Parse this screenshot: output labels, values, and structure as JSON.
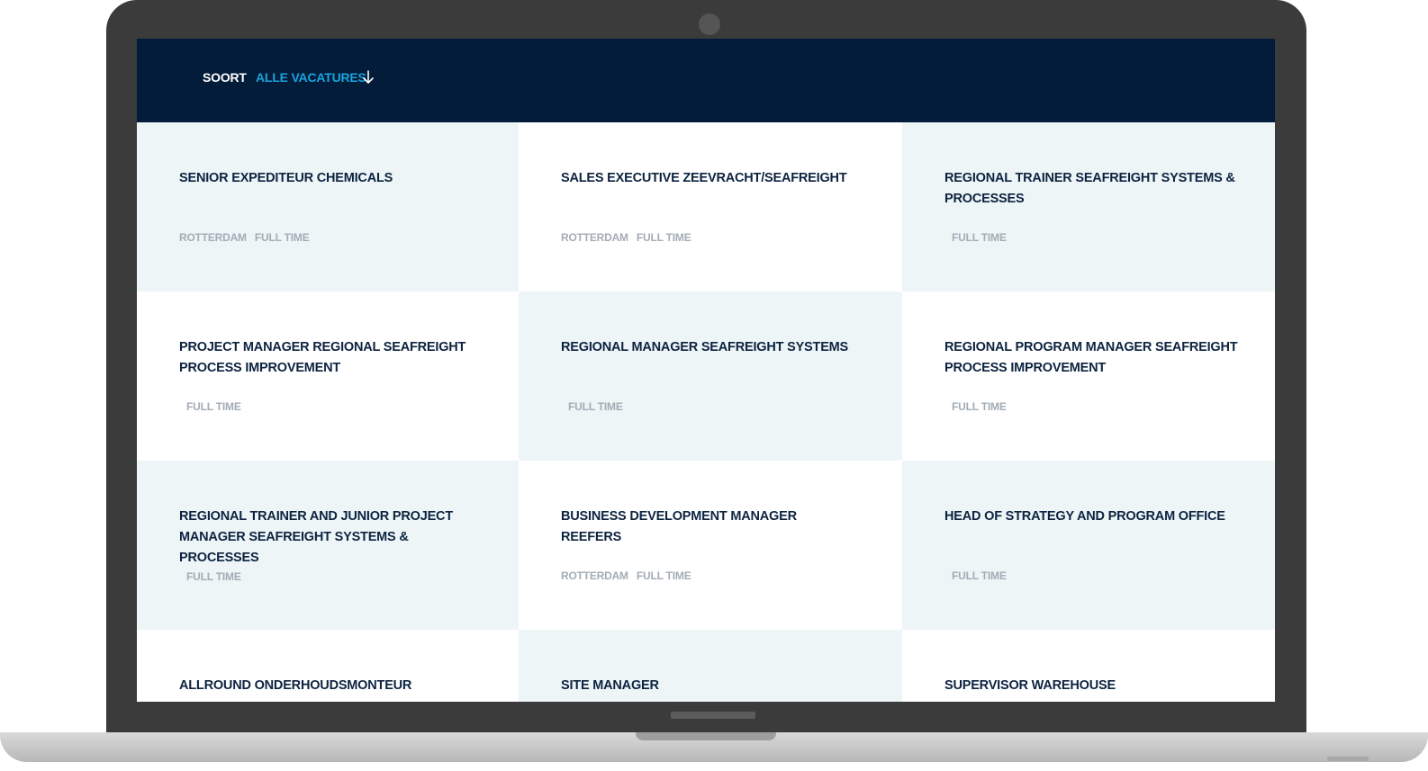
{
  "filter": {
    "label": "SOORT",
    "value": "ALLE VACATURES",
    "accent_color": "#1aa3dd",
    "header_bg": "#021c3a",
    "icon": "arrow-down-icon"
  },
  "jobs": [
    {
      "title": "SENIOR EXPEDITEUR CHEMICALS",
      "location": "ROTTERDAM",
      "type": "FULL TIME"
    },
    {
      "title": "SALES EXECUTIVE ZEEVRACHT/SEAFREIGHT",
      "location": "ROTTERDAM",
      "type": "FULL TIME"
    },
    {
      "title": "REGIONAL TRAINER SEAFREIGHT SYSTEMS & PROCESSES",
      "location": "",
      "type": "FULL TIME"
    },
    {
      "title": "PROJECT MANAGER REGIONAL SEAFREIGHT PROCESS IMPROVEMENT",
      "location": "",
      "type": "FULL TIME"
    },
    {
      "title": "REGIONAL MANAGER SEAFREIGHT SYSTEMS",
      "location": "",
      "type": "FULL TIME"
    },
    {
      "title": "REGIONAL PROGRAM MANAGER SEAFREIGHT PROCESS IMPROVEMENT",
      "location": "",
      "type": "FULL TIME"
    },
    {
      "title": "REGIONAL TRAINER AND JUNIOR PROJECT MANAGER SEAFREIGHT SYSTEMS & PROCESSES",
      "location": "",
      "type": "FULL TIME"
    },
    {
      "title": "BUSINESS DEVELOPMENT MANAGER REEFERS",
      "location": "ROTTERDAM",
      "type": "FULL TIME"
    },
    {
      "title": "HEAD OF STRATEGY AND PROGRAM OFFICE",
      "location": "",
      "type": "FULL TIME"
    },
    {
      "title": "ALLROUND ONDERHOUDSMONTEUR",
      "location": "",
      "type": ""
    },
    {
      "title": "SITE MANAGER",
      "location": "",
      "type": ""
    },
    {
      "title": "SUPERVISOR WAREHOUSE",
      "location": "",
      "type": ""
    }
  ]
}
